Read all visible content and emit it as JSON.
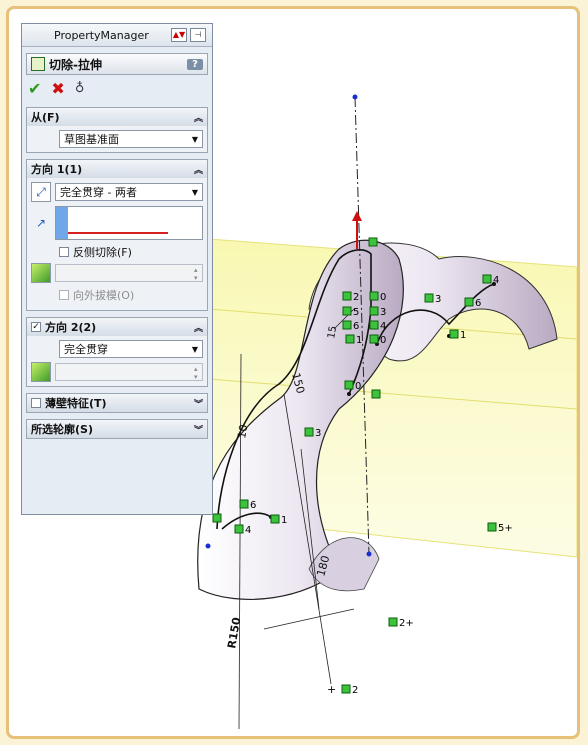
{
  "property_manager": {
    "title": "PropertyManager",
    "feature_name": "切除-拉伸",
    "help_label": "?",
    "actions": {
      "ok_icon": "✔",
      "cancel_icon": "✖",
      "detail_icon": "♁"
    },
    "from": {
      "header": "从(F)",
      "value": "草图基准面"
    },
    "direction1": {
      "header": "方向 1(1)",
      "end_condition": "完全贯穿 - 两者",
      "flip_side_label": "反侧切除(F)",
      "draft_label": "向外拔模(O)"
    },
    "direction2": {
      "header": "方向 2(2)",
      "end_condition": "完全贯穿"
    },
    "thin_feature": {
      "header": "薄壁特征(T)"
    },
    "selected_contours": {
      "header": "所选轮廓(S)"
    }
  },
  "graphics": {
    "dimensions": [
      "10",
      "180",
      "R150",
      "150",
      "15"
    ],
    "marker_labels": [
      "2",
      "5",
      "6",
      "1",
      "0",
      "3",
      "4",
      "3",
      "1",
      "6",
      "4",
      "1",
      "0",
      "3",
      "1",
      "6",
      "5+",
      "2+",
      "2"
    ]
  },
  "colors": {
    "plane": "#f7f48a",
    "body": "#ebe6f0",
    "accent": "#e7c07a",
    "marker": "#3cc23c"
  }
}
